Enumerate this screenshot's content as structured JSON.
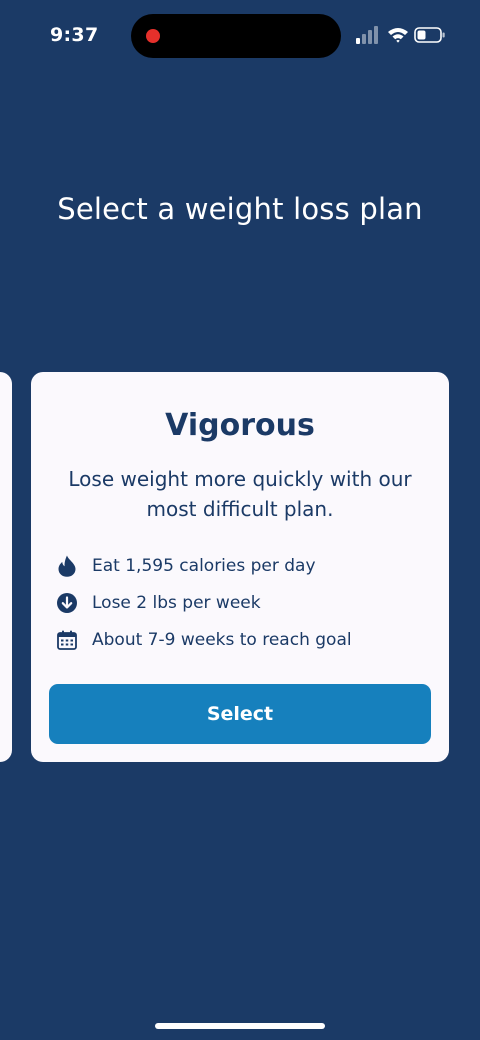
{
  "status_bar": {
    "time": "9:37",
    "icons": [
      "recording-dot-icon",
      "cellular-signal-icon",
      "wifi-icon",
      "battery-icon"
    ]
  },
  "page": {
    "title": "Select a weight loss plan"
  },
  "plan": {
    "name": "Vigorous",
    "description": "Lose weight more quickly with our most difficult plan.",
    "features": [
      {
        "icon": "flame-icon",
        "text": "Eat 1,595 calories per day"
      },
      {
        "icon": "arrow-down-circle-icon",
        "text": "Lose 2 lbs per week"
      },
      {
        "icon": "calendar-icon",
        "text": "About 7-9 weeks to reach goal"
      }
    ],
    "button_label": "Select"
  },
  "colors": {
    "background": "#1b3a66",
    "card": "#fbf9fd",
    "primary_text": "#1b3a66",
    "button": "#1680bd",
    "record_dot": "#e5302b"
  }
}
